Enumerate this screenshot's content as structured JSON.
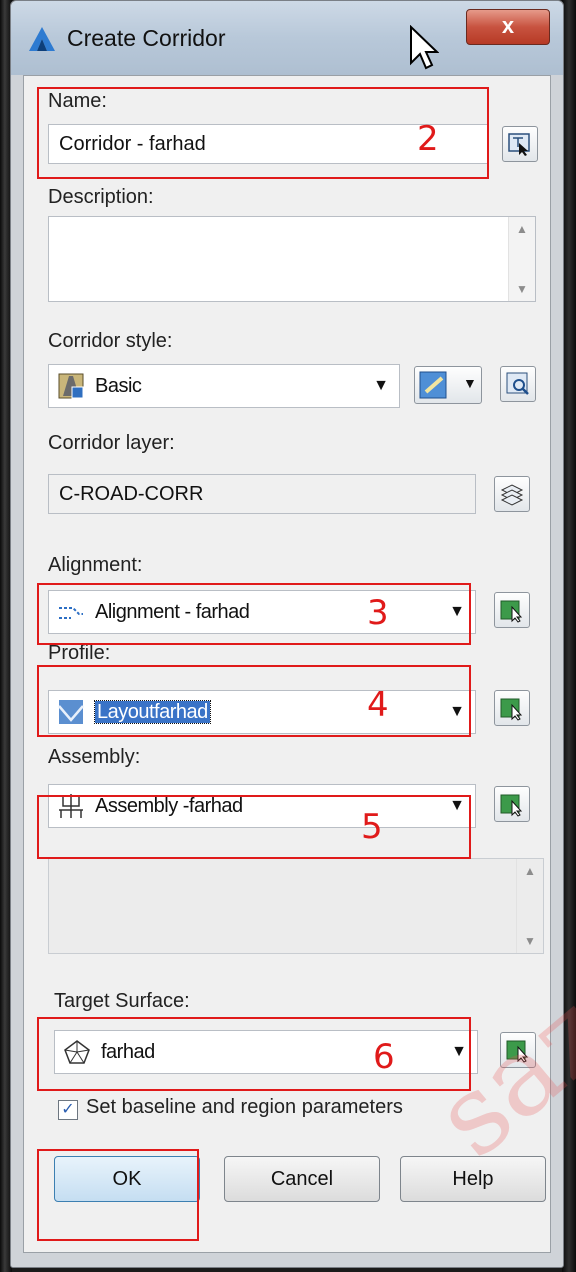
{
  "window": {
    "title": "Create Corridor",
    "close_label": "x"
  },
  "fields": {
    "name_label": "Name:",
    "name_value": "Corridor - farhad",
    "description_label": "Description:",
    "description_value": "",
    "corridor_style_label": "Corridor style:",
    "corridor_style_value": "Basic",
    "corridor_layer_label": "Corridor layer:",
    "corridor_layer_value": "C-ROAD-CORR",
    "alignment_label": "Alignment:",
    "alignment_value": "Alignment - farhad",
    "profile_label": "Profile:",
    "profile_value": "Layoutfarhad",
    "assembly_label": "Assembly:",
    "assembly_value": "Assembly -farhad",
    "target_surface_label": "Target Surface:",
    "target_surface_value": "farhad",
    "baseline_checkbox_label": "Set baseline and region parameters",
    "baseline_checked": true
  },
  "buttons": {
    "ok": "OK",
    "cancel": "Cancel",
    "help": "Help"
  },
  "annotations": [
    "2",
    "3",
    "4",
    "5",
    "6"
  ],
  "watermark": "saz",
  "colors": {
    "annotation_red": "#e01a1a",
    "selection_blue": "#3a73c7"
  }
}
